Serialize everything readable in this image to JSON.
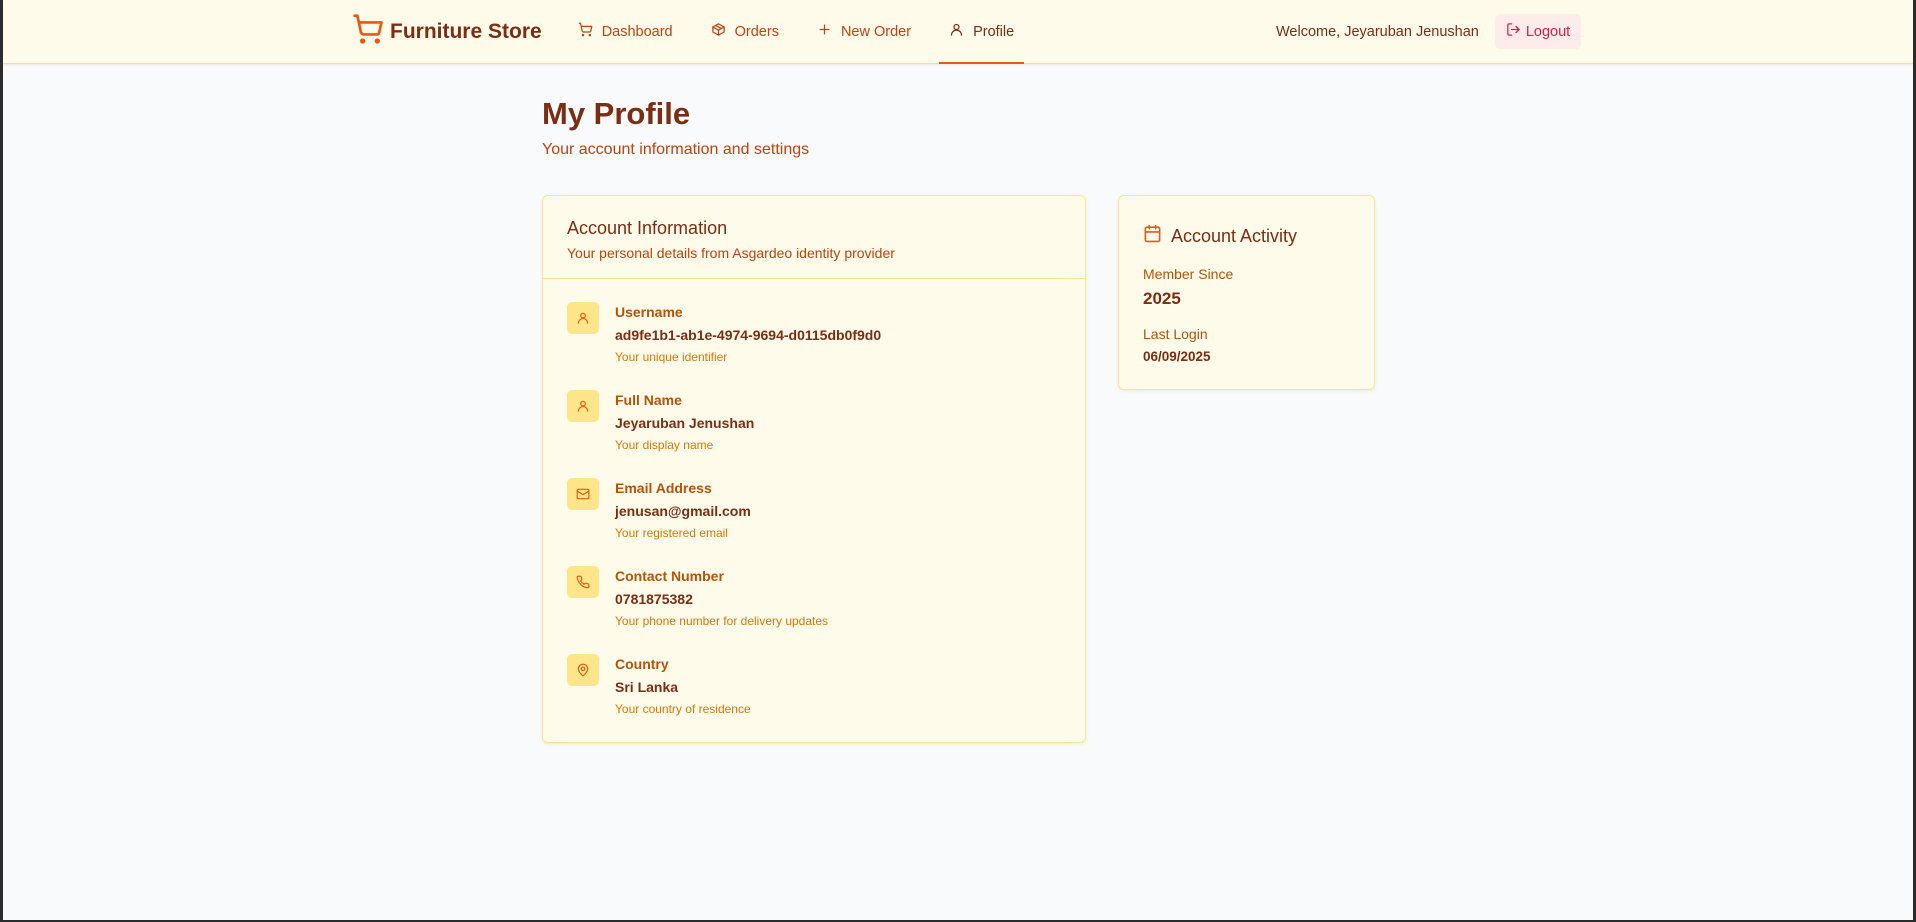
{
  "brand": {
    "name": "Furniture Store",
    "icon": "shopping-cart-icon",
    "accent": "#ea580c"
  },
  "nav": [
    {
      "label": "Dashboard",
      "icon": "shopping-cart-icon",
      "active": false
    },
    {
      "label": "Orders",
      "icon": "package-icon",
      "active": false
    },
    {
      "label": "New Order",
      "icon": "plus-icon",
      "active": false
    },
    {
      "label": "Profile",
      "icon": "user-icon",
      "active": true
    }
  ],
  "user": {
    "welcome": "Welcome, Jeyaruban Jenushan",
    "logout_label": "Logout"
  },
  "page": {
    "title": "My Profile",
    "subtitle": "Your account information and settings"
  },
  "account_info": {
    "title": "Account Information",
    "description": "Your personal details from Asgardeo identity provider",
    "fields": [
      {
        "label": "Username",
        "value": "ad9fe1b1-ab1e-4974-9694-d0115db0f9d0",
        "hint": "Your unique identifier",
        "icon": "user-icon"
      },
      {
        "label": "Full Name",
        "value": "Jeyaruban Jenushan",
        "hint": "Your display name",
        "icon": "user-icon"
      },
      {
        "label": "Email Address",
        "value": "jenusan@gmail.com",
        "hint": "Your registered email",
        "icon": "mail-icon"
      },
      {
        "label": "Contact Number",
        "value": "0781875382",
        "hint": "Your phone number for delivery updates",
        "icon": "phone-icon"
      },
      {
        "label": "Country",
        "value": "Sri Lanka",
        "hint": "Your country of residence",
        "icon": "map-pin-icon"
      }
    ]
  },
  "activity": {
    "title": "Account Activity",
    "icon": "calendar-icon",
    "member_since_label": "Member Since",
    "member_since_value": "2025",
    "last_login_label": "Last Login",
    "last_login_value": "06/09/2025"
  }
}
